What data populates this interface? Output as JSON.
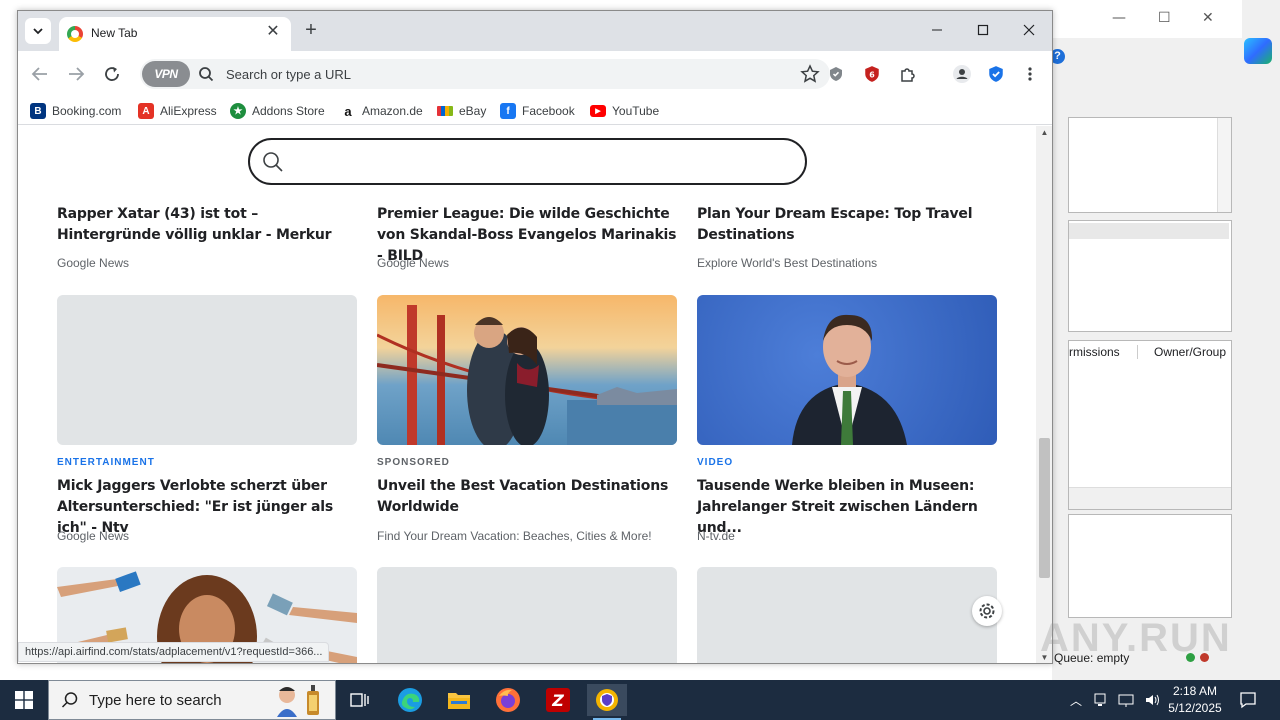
{
  "browser": {
    "tab": {
      "title": "New Tab"
    },
    "omnibox": {
      "vpn_label": "VPN",
      "placeholder": "Search or type a URL"
    },
    "bookmarks": [
      {
        "label": "Booking.com",
        "icon": "booking-icon",
        "color": "#003580",
        "glyph": "B"
      },
      {
        "label": "AliExpress",
        "icon": "aliexpress-icon",
        "color": "#e43225",
        "glyph": "A"
      },
      {
        "label": "Addons Store",
        "icon": "addons-store-icon",
        "color": "#1e8e3e",
        "glyph": "★"
      },
      {
        "label": "Amazon.de",
        "icon": "amazon-icon",
        "color": "#ffffff",
        "glyph": "a"
      },
      {
        "label": "eBay",
        "icon": "ebay-icon",
        "color": "#ffffff",
        "glyph": ""
      },
      {
        "label": "Facebook",
        "icon": "facebook-icon",
        "color": "#1877f2",
        "glyph": "f"
      },
      {
        "label": "YouTube",
        "icon": "youtube-icon",
        "color": "#ff0000",
        "glyph": "▶"
      }
    ],
    "feed": [
      {
        "category": "",
        "headline": "Rapper Xatar (43) ist tot – Hintergründe völlig unklar - Merkur",
        "source": "Google News"
      },
      {
        "category": "",
        "headline": "Premier League: Die wilde Geschichte von Skandal-Boss Evangelos Marinakis - BILD",
        "source": "Google News"
      },
      {
        "category": "",
        "headline": "Plan Your Dream Escape: Top Travel Destinations",
        "source": "Explore World's Best Destinations"
      },
      {
        "category": "ENTERTAINMENT",
        "category_color": "#1a73e8",
        "headline": "Mick Jaggers Verlobte scherzt über Altersunterschied: \"Er ist jünger als ich\" - Ntv",
        "source": "Google News"
      },
      {
        "category": "SPONSORED",
        "category_color": "#5f6368",
        "headline": "Unveil the Best Vacation Destinations Worldwide",
        "source": "Find Your Dream Vacation: Beaches, Cities & More!"
      },
      {
        "category": "VIDEO",
        "category_color": "#1a73e8",
        "headline": "Tausende Werke bleiben in Museen: Jahrelanger Streit zwischen Ländern und...",
        "source": "N-tv.de"
      }
    ],
    "status_url": "https://api.airfind.com/stats/adplacement/v1?requestId=366..."
  },
  "background_window": {
    "col_permissions": "rmissions",
    "col_owner": "Owner/Group",
    "queue": "Queue: empty"
  },
  "taskbar": {
    "search_placeholder": "Type here to search",
    "time": "2:18 AM",
    "date": "5/12/2025"
  },
  "watermark": "ANY.RUN"
}
